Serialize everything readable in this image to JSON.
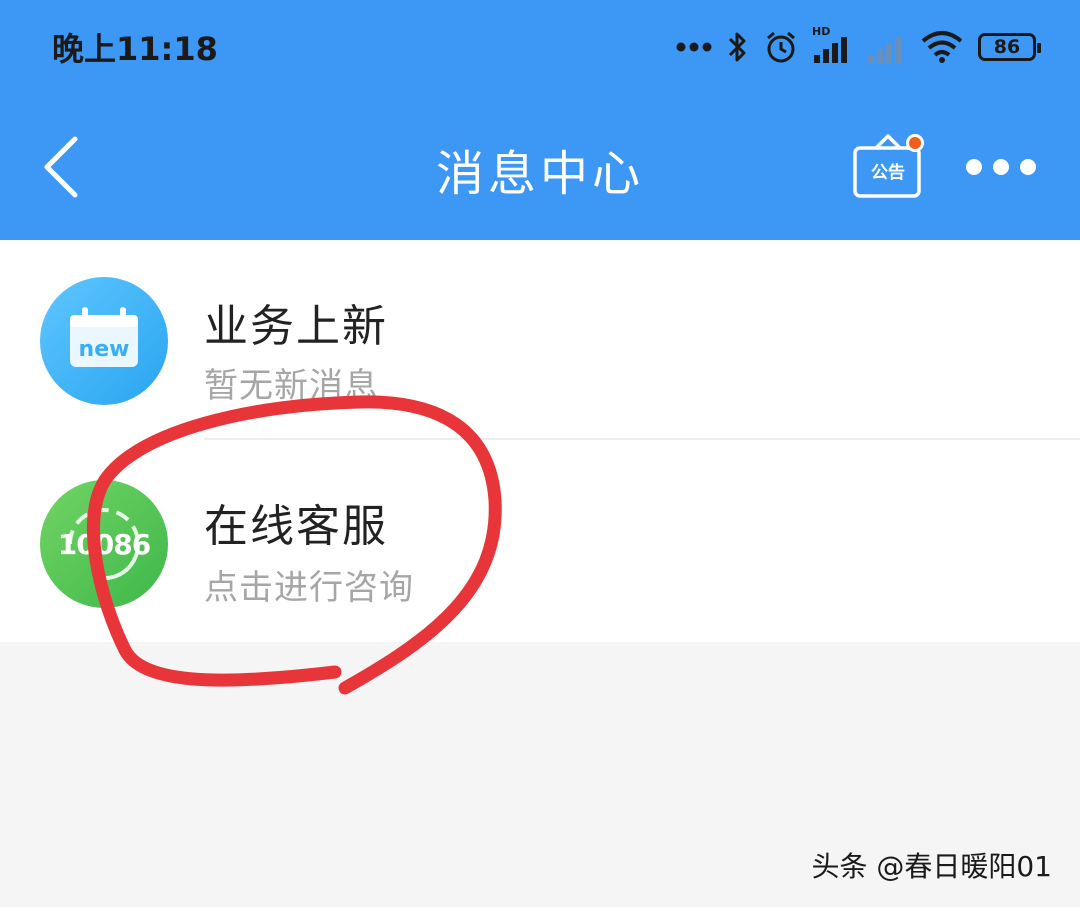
{
  "status_bar": {
    "time": "晚上11:18",
    "hd_label": "HD",
    "battery": "86"
  },
  "nav": {
    "title": "消息中心",
    "notice_label": "公告",
    "icons": [
      "back-arrow-icon",
      "notice-board-icon",
      "more-dots-icon"
    ]
  },
  "messages": [
    {
      "title": "业务上新",
      "subtitle": "暂无新消息",
      "avatar_text": "new",
      "avatar_icon": "calendar-new-icon"
    },
    {
      "title": "在线客服",
      "subtitle": "点击进行咨询",
      "avatar_text": "10086",
      "avatar_icon": "customer-service-icon"
    }
  ],
  "watermark": "头条 @春日暖阳01",
  "colors": {
    "header": "#3d97f5",
    "badge_dot": "#f25c1e",
    "annotation": "#e8353a",
    "avatar_new": "#3aaef2",
    "avatar_cs": "#4dc255"
  }
}
